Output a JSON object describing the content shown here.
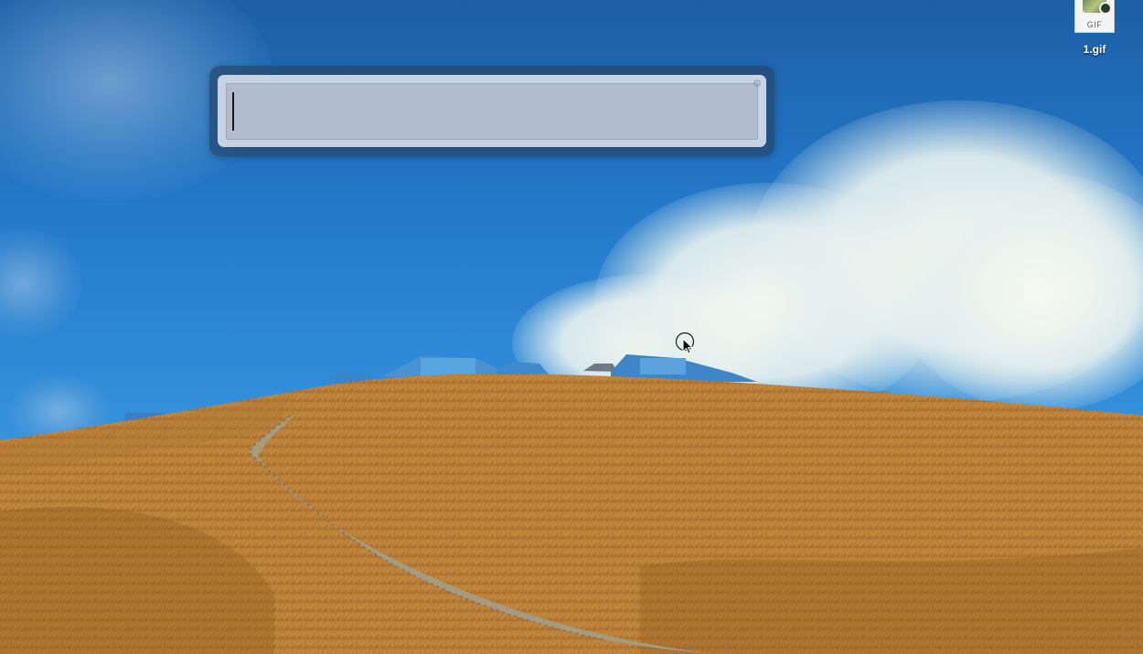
{
  "desktop": {
    "wallpaper": "blue-sky-clouds-golden-grass-hill",
    "colors": {
      "sky_top": "#1d5fa6",
      "sky_mid": "#2e8ad6",
      "cloud": "#f3f8ee",
      "grass": "#c48a3e",
      "grass_dark": "#9a6426"
    }
  },
  "spotlight": {
    "query": "",
    "placeholder": "",
    "settings_icon": "gear-icon"
  },
  "desktop_icons": [
    {
      "file_name": "1.gif",
      "thumb_label": "GIF",
      "icon": "image-file-icon"
    }
  ],
  "cursor": {
    "icon": "arrow-pointer-icon"
  }
}
